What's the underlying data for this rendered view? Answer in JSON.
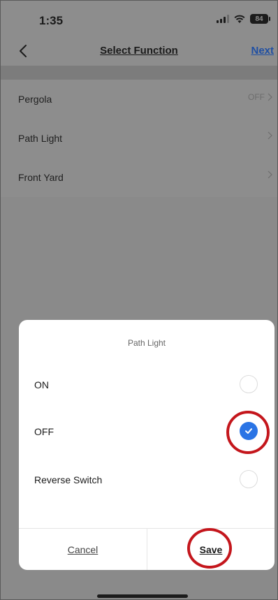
{
  "status_bar": {
    "time": "1:35",
    "battery_level": "84"
  },
  "nav": {
    "title": "Select Function",
    "next_label": "Next"
  },
  "list": {
    "items": [
      {
        "label": "Pergola",
        "value": "OFF"
      },
      {
        "label": "Path Light",
        "value": ""
      },
      {
        "label": "Front Yard",
        "value": ""
      }
    ]
  },
  "sheet": {
    "title": "Path Light",
    "options": [
      {
        "label": "ON",
        "selected": false
      },
      {
        "label": "OFF",
        "selected": true
      },
      {
        "label": "Reverse Switch",
        "selected": false
      }
    ],
    "cancel_label": "Cancel",
    "save_label": "Save"
  },
  "colors": {
    "accent": "#2a74e5",
    "link": "#1f4fa3",
    "highlight_ring": "#c4161c",
    "overlay": "#8d8d8d"
  }
}
